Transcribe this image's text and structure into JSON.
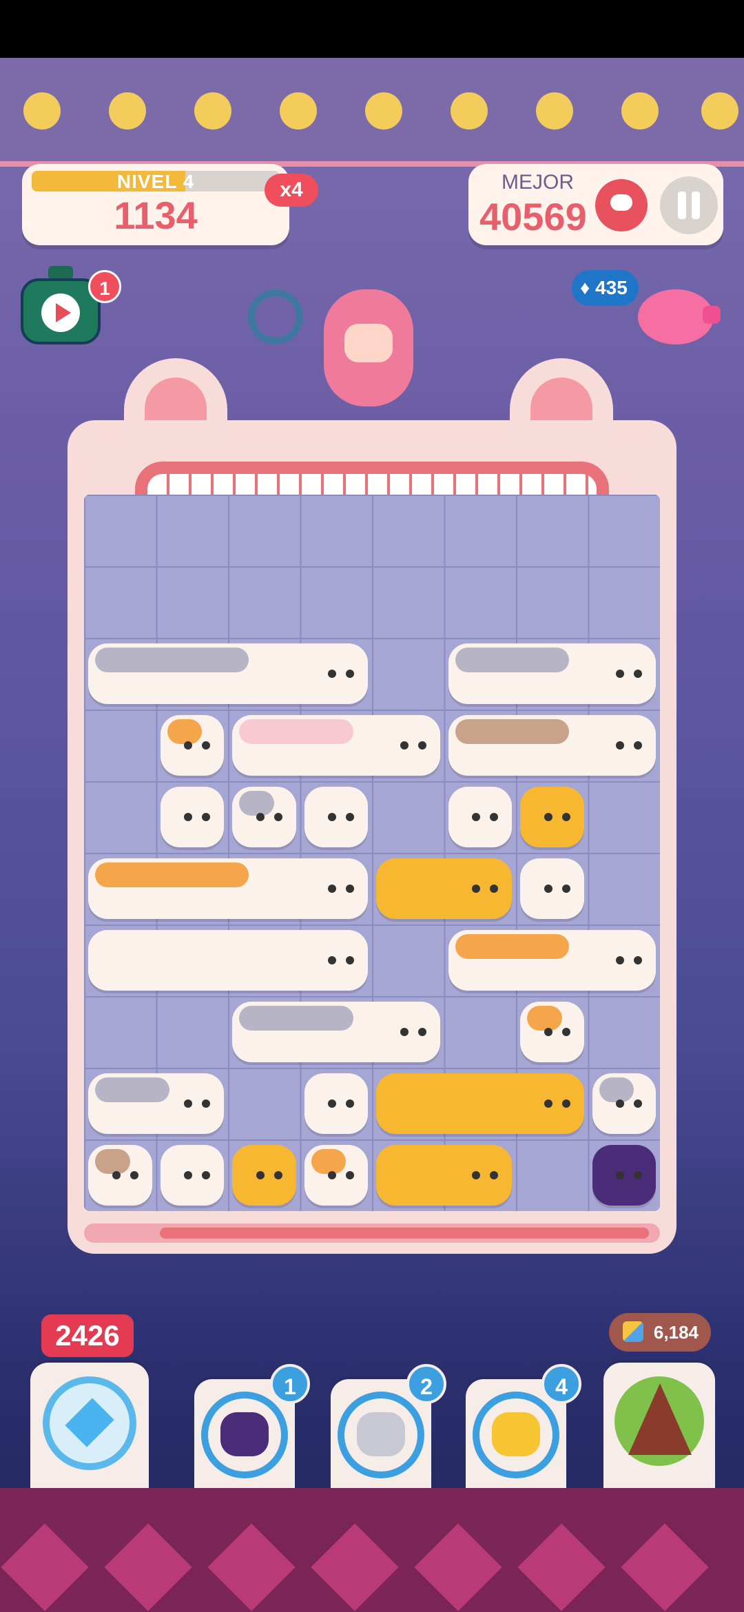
{
  "hud": {
    "level_label": "NIVEL 4",
    "score": "1134",
    "multiplier": "x4",
    "best_label": "MEJOR",
    "best_score": "40569",
    "level_progress": 0.62
  },
  "boosts": {
    "potion_badge": "1",
    "gems": "435"
  },
  "tools": {
    "gem_power": "2426",
    "thunder_cat_count": "1",
    "dash_cat_count": "2",
    "pet_cat_count": "4",
    "coins": "6,184"
  },
  "icons": [
    "potion-icon",
    "play-icon",
    "piggy-bank-icon",
    "diamond-icon",
    "teepee-icon",
    "pause-icon",
    "totem-icon"
  ],
  "colors": {
    "accent": "#e75f6c",
    "gem_blue": "#1f76c9",
    "tool_blue": "#3b9fe0",
    "cat_orange": "#f5a64a",
    "cat_gold": "#f7b731",
    "cat_gray": "#b7b4c6",
    "cat_siamese": "#c9a28a",
    "cat_white": "#fbf2ec"
  }
}
